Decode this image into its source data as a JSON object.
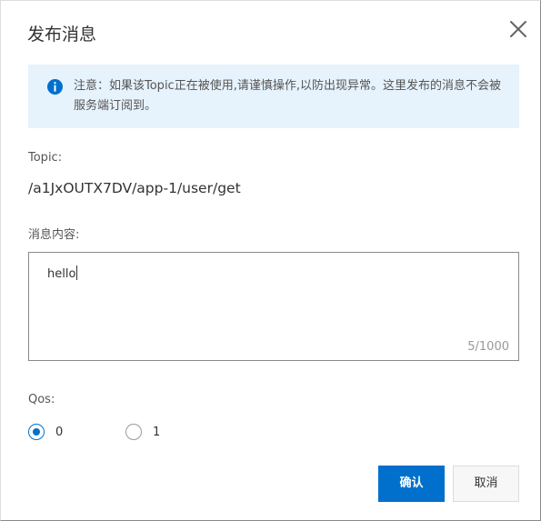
{
  "dialog": {
    "title": "发布消息",
    "close_icon": "close-icon"
  },
  "notice": {
    "icon": "info-icon",
    "text": "注意：如果该Topic正在被使用,请谨慎操作,以防出现异常。这里发布的消息不会被服务端订阅到。"
  },
  "topic": {
    "label": "Topic:",
    "value": "/a1JxOUTX7DV/app-1/user/get"
  },
  "message": {
    "label": "消息内容:",
    "value": "hello",
    "counter": "5/1000"
  },
  "qos": {
    "label": "Qos:",
    "options": [
      {
        "label": "0",
        "checked": true
      },
      {
        "label": "1",
        "checked": false
      }
    ]
  },
  "buttons": {
    "confirm": "确认",
    "cancel": "取消"
  },
  "colors": {
    "primary": "#0070cc",
    "notice_bg": "#e6f2fc"
  }
}
